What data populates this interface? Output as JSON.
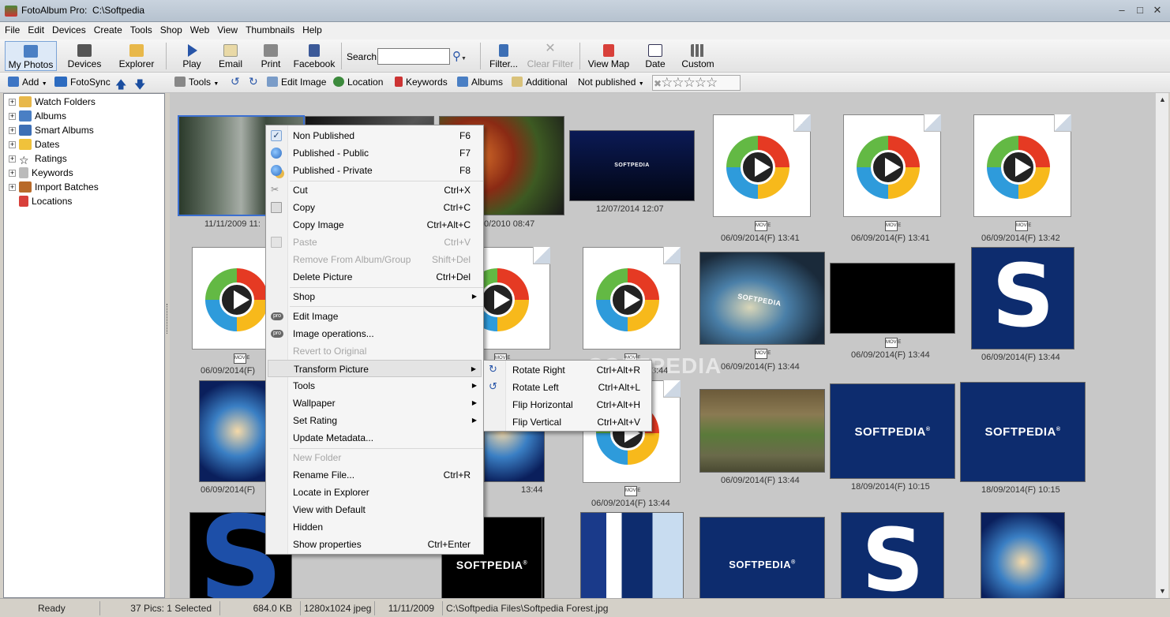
{
  "window": {
    "app_name": "FotoAlbum Pro:",
    "path": "C:\\Softpedia"
  },
  "menu": [
    "File",
    "Edit",
    "Devices",
    "Create",
    "Tools",
    "Shop",
    "Web",
    "View",
    "Thumbnails",
    "Help"
  ],
  "toolbar1": {
    "my_photos": "My Photos",
    "devices": "Devices",
    "explorer": "Explorer",
    "play": "Play",
    "email": "Email",
    "print": "Print",
    "facebook": "Facebook",
    "search_label": "Search",
    "search_value": "",
    "filter": "Filter...",
    "clear_filter": "Clear Filter",
    "view_map": "View Map",
    "date": "Date",
    "custom": "Custom"
  },
  "toolbar2": {
    "add": "Add",
    "fotosync": "FotoSync",
    "tools": "Tools",
    "edit_image": "Edit Image",
    "location": "Location",
    "keywords": "Keywords",
    "albums": "Albums",
    "additional": "Additional",
    "not_published": "Not published",
    "rating_stars": "☆☆☆☆☆"
  },
  "sidebar": {
    "items": [
      "Watch Folders",
      "Albums",
      "Smart Albums",
      "Dates",
      "Ratings",
      "Keywords",
      "Import Batches",
      "Locations"
    ]
  },
  "thumbnails": {
    "captions": {
      "r1c1": "11/11/2009  11:",
      "r1c3": "0/2010  08:47",
      "r1c4": "12/07/2014  12:07",
      "r1c5": "06/09/2014(F)  13:41",
      "r1c6": "06/09/2014(F)  13:41",
      "r1c7": "06/09/2014(F)  13:42",
      "r2c1": "06/09/2014(F)",
      "r2c4": "3:44",
      "r2c5": "06/09/2014(F)  13:44",
      "r2c6": "06/09/2014(F)  13:44",
      "r2c7": "06/09/2014(F)  13:44",
      "r3c1": "06/09/2014(F)",
      "r3c3": "13:44",
      "r3c4": "06/09/2014(F)  13:44",
      "r3c5": "06/09/2014(F)  13:44",
      "r3c6": "18/09/2014(F)  10:15",
      "r3c7": "18/09/2014(F)  10:15"
    },
    "logo_text": "SOFTPEDIA",
    "logo_sup": "®",
    "big_s": "S",
    "icon_text": "MOVIE",
    "watermark": "SOFTPEDIA"
  },
  "context_menu": {
    "items": [
      {
        "label": "Non Published",
        "shortcut": "F6"
      },
      {
        "label": "Published - Public",
        "shortcut": "F7"
      },
      {
        "label": "Published - Private",
        "shortcut": "F8"
      },
      {
        "label": "Cut",
        "shortcut": "Ctrl+X"
      },
      {
        "label": "Copy",
        "shortcut": "Ctrl+C"
      },
      {
        "label": "Copy Image",
        "shortcut": "Ctrl+Alt+C"
      },
      {
        "label": "Paste",
        "shortcut": "Ctrl+V"
      },
      {
        "label": "Remove From Album/Group",
        "shortcut": "Shift+Del"
      },
      {
        "label": "Delete Picture",
        "shortcut": "Ctrl+Del"
      },
      {
        "label": "Shop",
        "shortcut": ""
      },
      {
        "label": "Edit Image",
        "shortcut": ""
      },
      {
        "label": "Image operations...",
        "shortcut": ""
      },
      {
        "label": "Revert to Original",
        "shortcut": ""
      },
      {
        "label": "Transform Picture",
        "shortcut": ""
      },
      {
        "label": "Tools",
        "shortcut": ""
      },
      {
        "label": "Wallpaper",
        "shortcut": ""
      },
      {
        "label": "Set Rating",
        "shortcut": ""
      },
      {
        "label": "Update Metadata...",
        "shortcut": ""
      },
      {
        "label": "New Folder",
        "shortcut": ""
      },
      {
        "label": "Rename File...",
        "shortcut": "Ctrl+R"
      },
      {
        "label": "Locate in Explorer",
        "shortcut": ""
      },
      {
        "label": "View with Default",
        "shortcut": ""
      },
      {
        "label": "Hidden",
        "shortcut": ""
      },
      {
        "label": "Show properties",
        "shortcut": "Ctrl+Enter"
      }
    ],
    "check_mark": "✓",
    "submenu_arrow": "▶",
    "pro_badge": "pro"
  },
  "transform_submenu": {
    "items": [
      {
        "label": "Rotate Right",
        "shortcut": "Ctrl+Alt+R"
      },
      {
        "label": "Rotate Left",
        "shortcut": "Ctrl+Alt+L"
      },
      {
        "label": "Flip Horizontal",
        "shortcut": "Ctrl+Alt+H"
      },
      {
        "label": "Flip Vertical",
        "shortcut": "Ctrl+Alt+V"
      }
    ]
  },
  "statusbar": {
    "status": "Ready",
    "count": "37 Pics: 1 Selected",
    "size": "684.0 KB",
    "dims": "1280x1024 jpeg",
    "date": "11/11/2009",
    "path": "C:\\Softpedia Files\\Softpedia Forest.jpg"
  }
}
